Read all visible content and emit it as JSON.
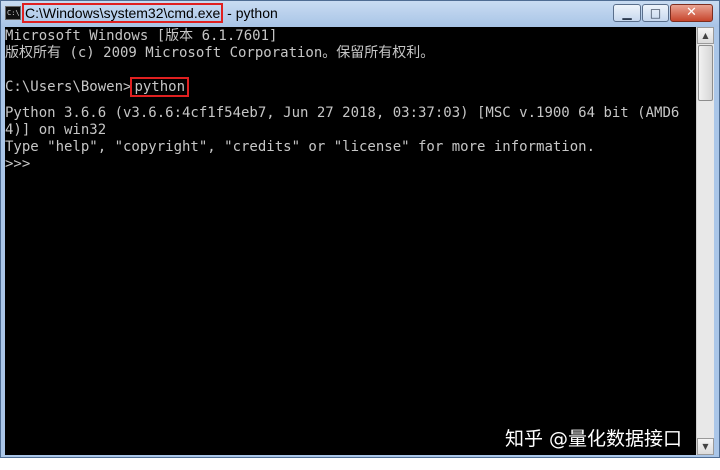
{
  "window": {
    "title_path": "C:\\Windows\\system32\\cmd.exe",
    "title_suffix": " - python",
    "icon": "cmd-icon",
    "controls": {
      "minimize_icon": "minimize-icon",
      "maximize_icon": "maximize-icon",
      "close_icon": "close-icon"
    }
  },
  "console": {
    "lines": [
      "Microsoft Windows [版本 6.1.7601]",
      "版权所有 (c) 2009 Microsoft Corporation。保留所有权利。",
      "",
      "",
      "Python 3.6.6 (v3.6.6:4cf1f54eb7, Jun 27 2018, 03:37:03) [MSC v.1900 64 bit (AMD6",
      "4)] on win32",
      "Type \"help\", \"copyright\", \"credits\" or \"license\" for more information.",
      ">>> "
    ],
    "prompt": "C:\\Users\\Bowen>",
    "command": "python",
    "text_color": "#c6c6c6",
    "background": "#000000"
  },
  "annotation_color": "#e02020",
  "watermark": "知乎 @量化数据接口"
}
